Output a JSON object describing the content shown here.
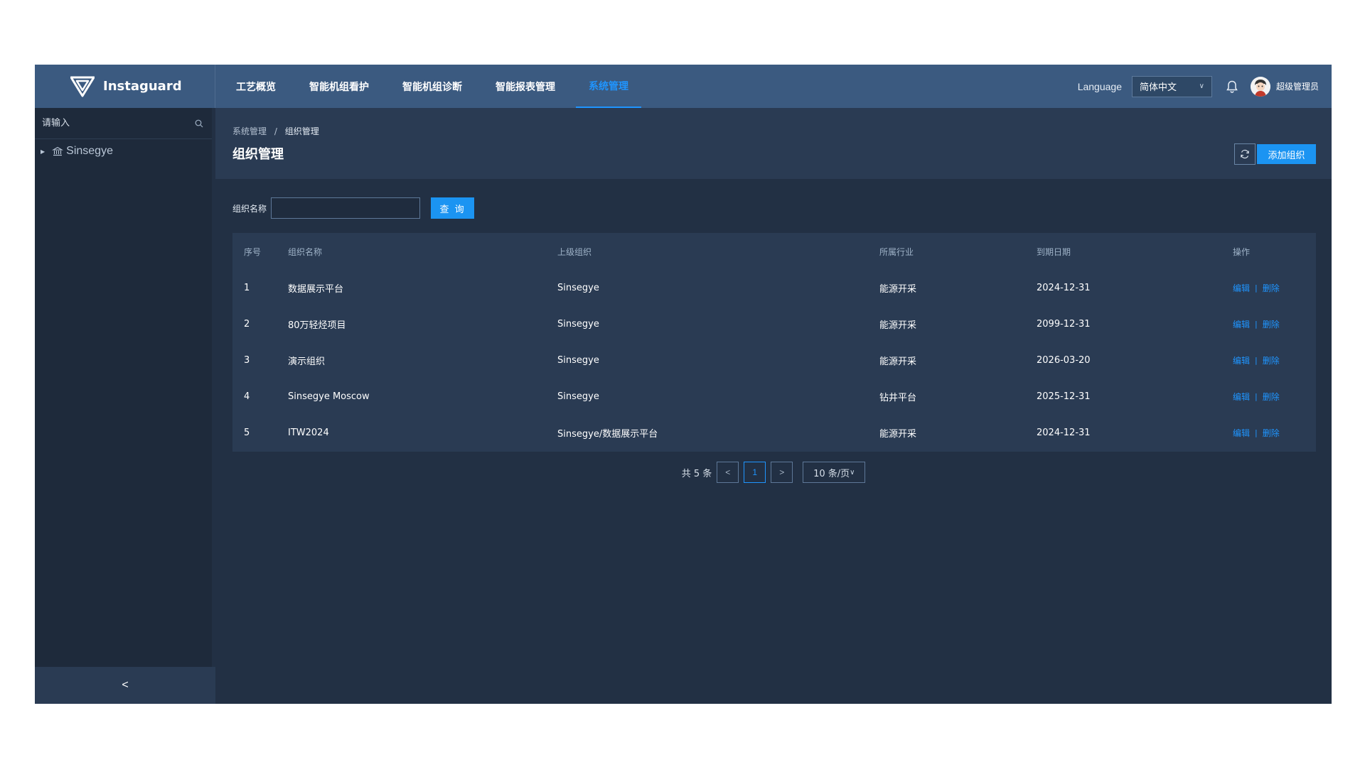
{
  "brand": {
    "name": "Instaguard"
  },
  "nav": {
    "items": [
      {
        "label": "工艺概览"
      },
      {
        "label": "智能机组看护"
      },
      {
        "label": "智能机组诊断"
      },
      {
        "label": "智能报表管理"
      },
      {
        "label": "系统管理",
        "active": true
      }
    ]
  },
  "header": {
    "language_label": "Language",
    "language_value": "简体中文",
    "user_name": "超级管理员"
  },
  "sidebar": {
    "search_placeholder": "请输入",
    "tree": [
      {
        "label": "Sinsegye"
      }
    ],
    "collapse_label": "<"
  },
  "page": {
    "breadcrumb": [
      "系统管理",
      "组织管理"
    ],
    "breadcrumb_sep": "/",
    "title": "组织管理",
    "add_button": "添加组织"
  },
  "filter": {
    "label": "组织名称",
    "value": "",
    "query_button": "查 询"
  },
  "table": {
    "columns": [
      "序号",
      "组织名称",
      "上级组织",
      "所属行业",
      "到期日期",
      "操作"
    ],
    "rows": [
      {
        "no": "1",
        "name": "数据展示平台",
        "parent": "Sinsegye",
        "industry": "能源开采",
        "expiry": "2024-12-31"
      },
      {
        "no": "2",
        "name": "80万轻烃项目",
        "parent": "Sinsegye",
        "industry": "能源开采",
        "expiry": "2099-12-31"
      },
      {
        "no": "3",
        "name": "演示组织",
        "parent": "Sinsegye",
        "industry": "能源开采",
        "expiry": "2026-03-20"
      },
      {
        "no": "4",
        "name": "Sinsegye Moscow",
        "parent": "Sinsegye",
        "industry": "钻井平台",
        "expiry": "2025-12-31"
      },
      {
        "no": "5",
        "name": "ITW2024",
        "parent": "Sinsegye/数据展示平台",
        "industry": "能源开采",
        "expiry": "2024-12-31"
      }
    ],
    "edit_label": "编辑",
    "delete_label": "删除",
    "op_sep": "|"
  },
  "pagination": {
    "total": "共 5 条",
    "prev": "<",
    "current_page": "1",
    "next": ">",
    "page_size": "10 条/页"
  },
  "colors": {
    "topbar": "#3b5a80",
    "background": "#223044",
    "panel": "#2a3b53",
    "accent": "#1b94f2",
    "link": "#1f95ff"
  }
}
